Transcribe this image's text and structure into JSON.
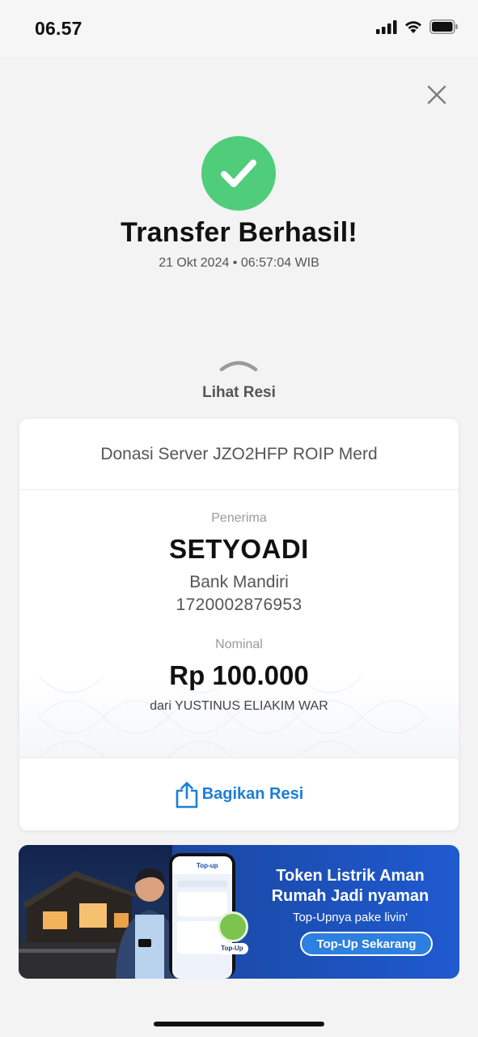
{
  "status_bar": {
    "time": "06.57"
  },
  "header": {
    "title": "Transfer Berhasil!",
    "datetime": "21 Okt 2024 • 06:57:04 WIB"
  },
  "receipt_toggle": {
    "label": "Lihat Resi"
  },
  "receipt": {
    "description": "Donasi Server  JZO2HFP ROIP Merd",
    "recipient_label": "Penerima",
    "recipient_name": "SETYOADI",
    "bank": "Bank Mandiri",
    "account_number": "1720002876953",
    "amount_label": "Nominal",
    "amount": "Rp 100.000",
    "sender": "dari YUSTINUS ELIAKIM WAR",
    "share_label": "Bagikan Resi"
  },
  "banner": {
    "line1": "Token Listrik Aman",
    "line2": "Rumah Jadi nyaman",
    "line3": "Top-Upnya pake livin'",
    "button": "Top-Up Sekarang",
    "phone_header": "Top-up",
    "badge": "Top-Up"
  },
  "colors": {
    "success_green": "#4fcd7b",
    "link_blue": "#1a7fd6",
    "banner_blue": "#1b4aa8"
  }
}
